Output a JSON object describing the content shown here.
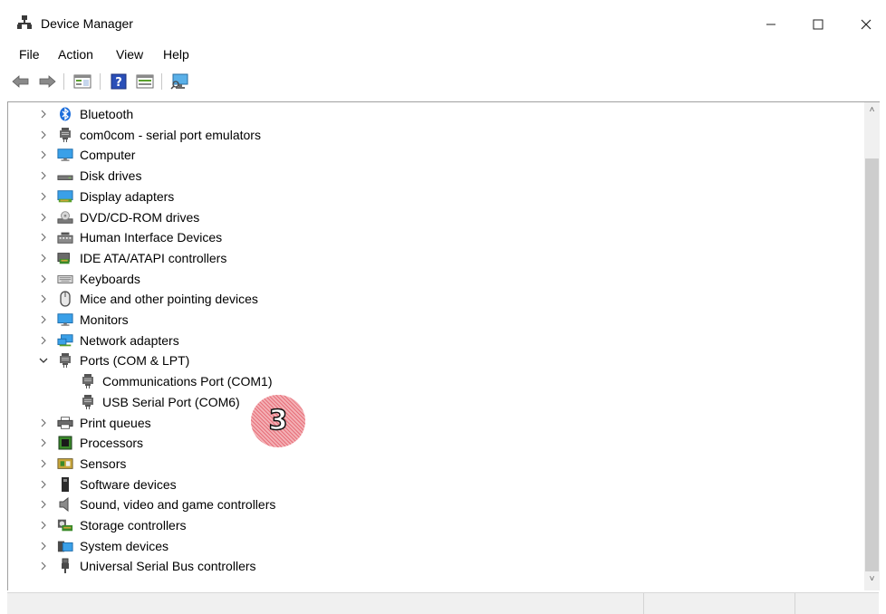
{
  "window": {
    "title": "Device Manager"
  },
  "menu": [
    {
      "label": "File"
    },
    {
      "label": "Action"
    },
    {
      "label": "View"
    },
    {
      "label": "Help"
    }
  ],
  "toolbar_buttons": [
    "back-icon",
    "forward-icon",
    "properties-icon",
    "help-icon",
    "show-hidden-icon",
    "scan-hardware-icon"
  ],
  "tree": [
    {
      "label": "Bluetooth",
      "expanded": false,
      "icon": "bluetooth-icon"
    },
    {
      "label": "com0com - serial port emulators",
      "expanded": false,
      "icon": "port-icon"
    },
    {
      "label": "Computer",
      "expanded": false,
      "icon": "computer-icon"
    },
    {
      "label": "Disk drives",
      "expanded": false,
      "icon": "disk-drive-icon"
    },
    {
      "label": "Display adapters",
      "expanded": false,
      "icon": "display-adapter-icon"
    },
    {
      "label": "DVD/CD-ROM drives",
      "expanded": false,
      "icon": "dvd-drive-icon"
    },
    {
      "label": "Human Interface Devices",
      "expanded": false,
      "icon": "hid-icon"
    },
    {
      "label": "IDE ATA/ATAPI controllers",
      "expanded": false,
      "icon": "ide-controller-icon"
    },
    {
      "label": "Keyboards",
      "expanded": false,
      "icon": "keyboard-icon"
    },
    {
      "label": "Mice and other pointing devices",
      "expanded": false,
      "icon": "mouse-icon"
    },
    {
      "label": "Monitors",
      "expanded": false,
      "icon": "monitor-icon"
    },
    {
      "label": "Network adapters",
      "expanded": false,
      "icon": "network-adapter-icon"
    },
    {
      "label": "Ports (COM & LPT)",
      "expanded": true,
      "icon": "port-icon",
      "children": [
        {
          "label": "Communications Port (COM1)",
          "icon": "port-icon"
        },
        {
          "label": "USB Serial Port (COM6)",
          "icon": "port-icon"
        }
      ]
    },
    {
      "label": "Print queues",
      "expanded": false,
      "icon": "printer-icon"
    },
    {
      "label": "Processors",
      "expanded": false,
      "icon": "processor-icon"
    },
    {
      "label": "Sensors",
      "expanded": false,
      "icon": "sensor-icon"
    },
    {
      "label": "Software devices",
      "expanded": false,
      "icon": "software-device-icon"
    },
    {
      "label": "Sound, video and game controllers",
      "expanded": false,
      "icon": "sound-icon"
    },
    {
      "label": "Storage controllers",
      "expanded": false,
      "icon": "storage-controller-icon"
    },
    {
      "label": "System devices",
      "expanded": false,
      "icon": "system-devices-icon"
    },
    {
      "label": "Universal Serial Bus controllers",
      "expanded": false,
      "icon": "usb-icon"
    }
  ],
  "annotation": {
    "number": "3",
    "color": "#e7707a"
  },
  "colors": {
    "accent": "#1e90ff",
    "scroll_thumb": "#cdcdcd"
  }
}
